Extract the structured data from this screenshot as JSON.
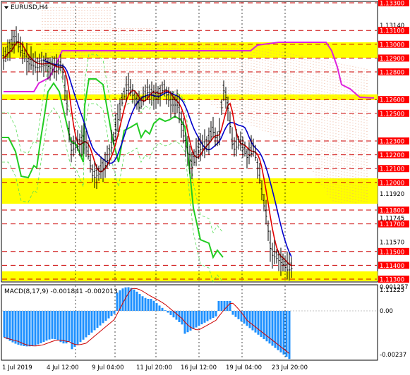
{
  "window": {
    "symbol_title": "EURUSD,H4",
    "macd_title": "MACD(8,17,9) -0.001841 -0.002013"
  },
  "colors": {
    "price_line": "#000000",
    "red_level": "#cc0000",
    "yellow_zone": "#ffff00",
    "red_ma": "#e00000",
    "blue_ma": "#0000cc",
    "green_line": "#22cc22",
    "magenta_line": "#dd22dd",
    "cloud_dots": "#e8a080",
    "macd_bar": "#1e90ff",
    "macd_signal": "#cc0000",
    "label_bg": "#ff0000",
    "label_text": "#ffffff"
  },
  "price_axis": {
    "labels": [
      {
        "text": "1.13300",
        "price": 1.133,
        "highlight": true
      },
      {
        "text": "1.13140",
        "price": 1.1314,
        "highlight": false
      },
      {
        "text": "1.13100",
        "price": 1.131,
        "highlight": true
      },
      {
        "text": "1.13000",
        "price": 1.13,
        "highlight": true
      },
      {
        "text": "1.12900",
        "price": 1.129,
        "highlight": true
      },
      {
        "text": "1.12800",
        "price": 1.128,
        "highlight": true
      },
      {
        "text": "1.12600",
        "price": 1.126,
        "highlight": true
      },
      {
        "text": "1.12500",
        "price": 1.125,
        "highlight": true
      },
      {
        "text": "1.12300",
        "price": 1.123,
        "highlight": true
      },
      {
        "text": "1.12200",
        "price": 1.122,
        "highlight": true
      },
      {
        "text": "1.12100",
        "price": 1.121,
        "highlight": true
      },
      {
        "text": "1.12000",
        "price": 1.12,
        "highlight": true
      },
      {
        "text": "1.11920",
        "price": 1.1192,
        "highlight": false
      },
      {
        "text": "1.11800",
        "price": 1.118,
        "highlight": true
      },
      {
        "text": "1.11745",
        "price": 1.11745,
        "highlight": false
      },
      {
        "text": "1.11700",
        "price": 1.117,
        "highlight": true
      },
      {
        "text": "1.11570",
        "price": 1.1157,
        "highlight": false
      },
      {
        "text": "1.11500",
        "price": 1.115,
        "highlight": true
      },
      {
        "text": "1.11400",
        "price": 1.114,
        "highlight": true
      },
      {
        "text": "1.11300",
        "price": 1.113,
        "highlight": true
      },
      {
        "text": "1.11225",
        "price": 1.11225,
        "highlight": false
      }
    ]
  },
  "macd_axis": {
    "labels": [
      "0.001257",
      "0.00",
      "-0.00237"
    ]
  },
  "time_axis": {
    "labels": [
      "1 Jul 2019",
      "4 Jul 12:00",
      "9 Jul 04:00",
      "11 Jul 20:00",
      "16 Jul 12:00",
      "19 Jul 04:00",
      "23 Jul 20:00"
    ]
  }
}
